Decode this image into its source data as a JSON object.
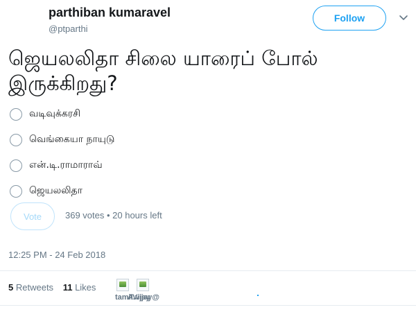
{
  "author": {
    "display_name": "parthiban kumaravel",
    "handle": "@ptparthi"
  },
  "follow_label": "Follow",
  "tweet_text": "ஜெயலலிதா சிலை யாரைப் போல் இருக்கிறது?",
  "poll": {
    "options": [
      {
        "label": "வடிவுக்கரசி"
      },
      {
        "label": "வெங்கையா நாயுடு"
      },
      {
        "label": "என்.டி.ராமாராவ்"
      },
      {
        "label": "ஜெயலலிதா"
      }
    ],
    "vote_label": "Vote",
    "meta": "369 votes • 20 hours left"
  },
  "timestamp": "12:25 PM - 24 Feb 2018",
  "stats": {
    "retweets_count": "5",
    "retweets_label": "Retweets",
    "likes_count": "11",
    "likes_label": "Likes"
  },
  "liker_avatars": [
    {
      "caption": "tamil.vijay@"
    },
    {
      "caption": "AVijay"
    }
  ],
  "colors": {
    "accent": "#1da1f2",
    "muted_text": "#657786",
    "text": "#14171a",
    "divider": "#e6ecf0"
  },
  "icons": {
    "menu": "chevron-down-icon",
    "poll_choice": "radio-circle-icon",
    "avatar_placeholder": "broken-image-icon"
  }
}
